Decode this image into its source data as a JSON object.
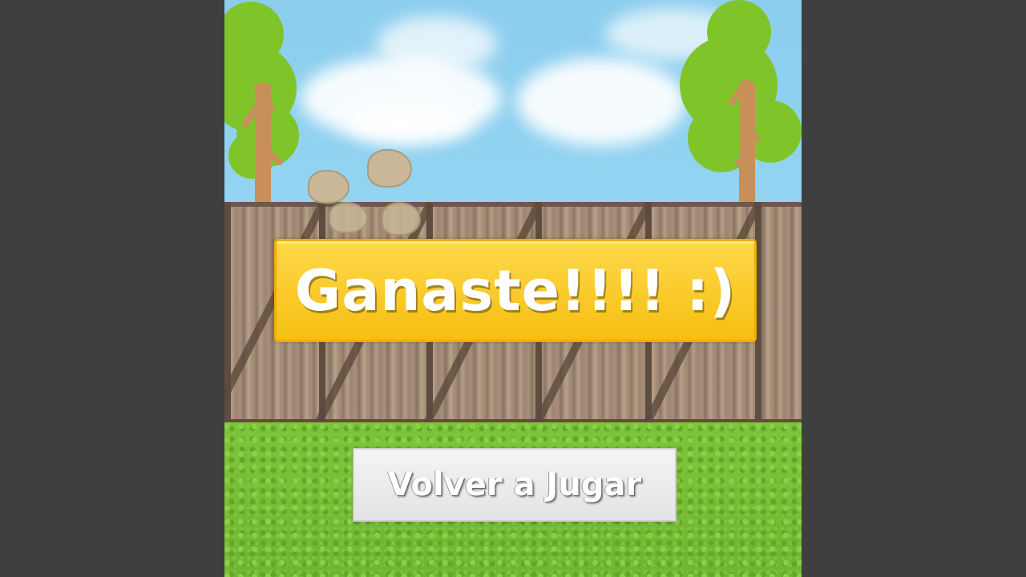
{
  "game": {
    "message": "Ganaste!!!! :)",
    "replay_button": "Volver a Jugar"
  },
  "colors": {
    "outer_background": "#3f3f3f",
    "sky": "#8dcfee",
    "banner": "#f5bf12",
    "grass": "#73bb35",
    "button": "#ececec"
  },
  "icons": [
    "tree",
    "dust-cloud",
    "fence"
  ]
}
